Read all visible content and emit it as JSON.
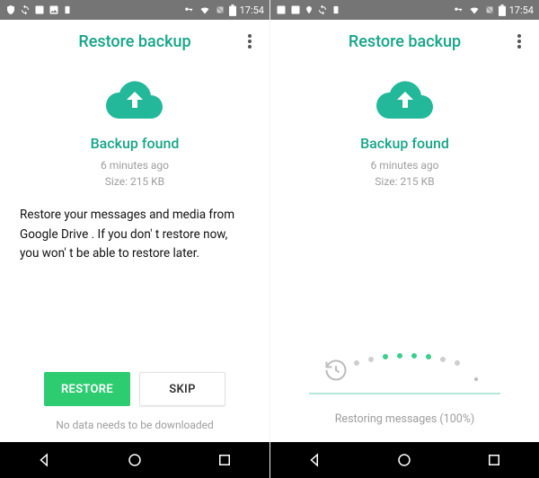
{
  "status": {
    "time": "17:54"
  },
  "appbar": {
    "title": "Restore backup"
  },
  "backup": {
    "found_label": "Backup found",
    "age": "6 minutes ago",
    "size": "Size: 215 KB"
  },
  "left": {
    "description": "Restore your messages and media from Google Drive . If you don' t restore now, you won' t be able to restore later.",
    "restore_label": "RESTORE",
    "skip_label": "SKIP",
    "footer": "No data needs to be downloaded"
  },
  "right": {
    "progress_label": "Restoring messages (100%)"
  }
}
